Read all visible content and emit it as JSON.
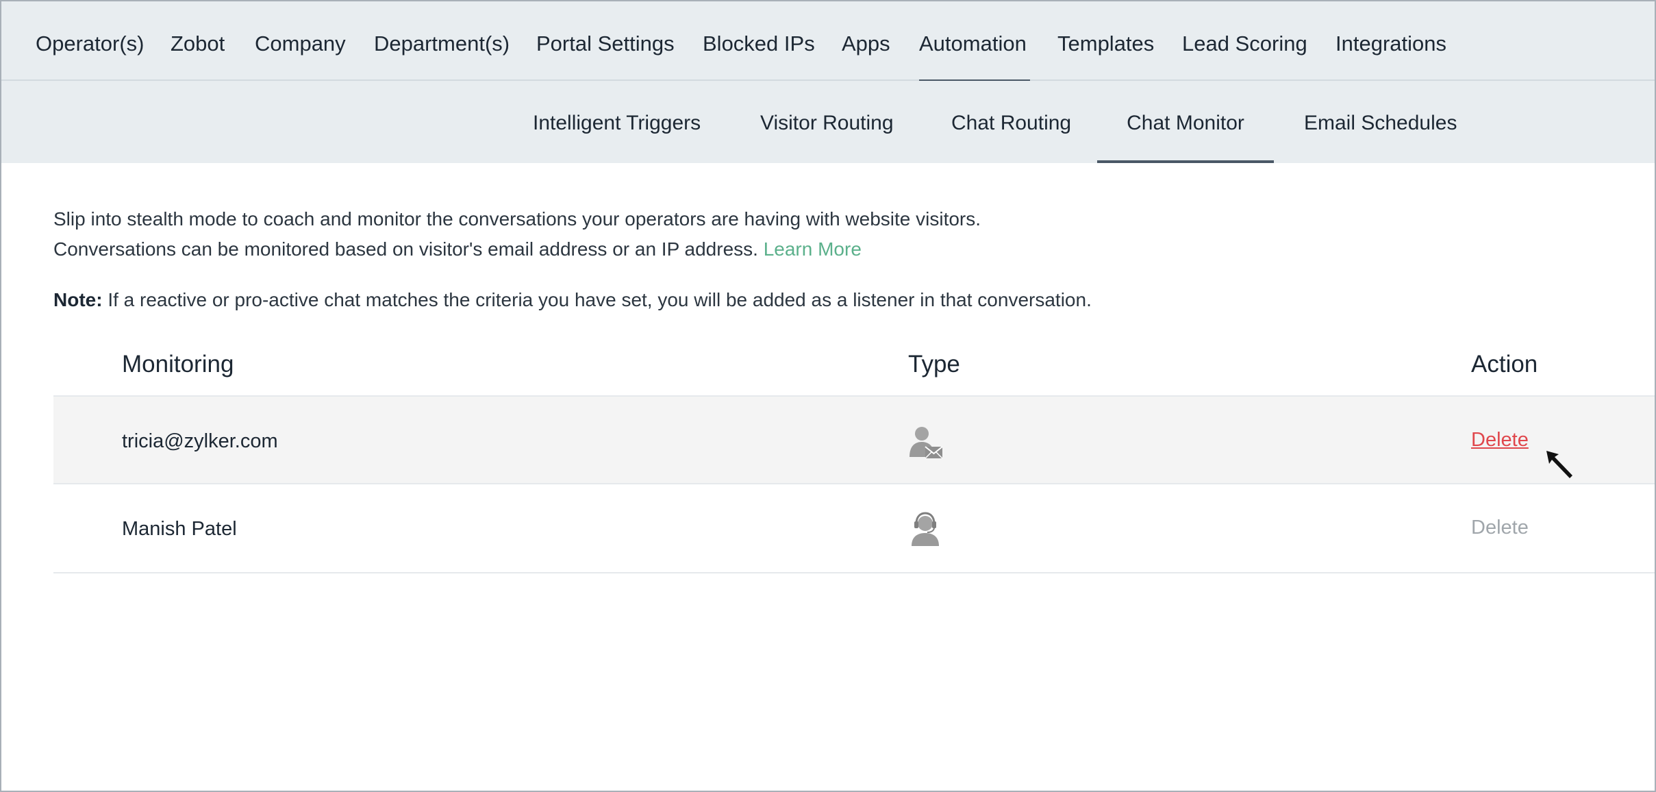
{
  "top_tabs": [
    {
      "label": "Operator(s)"
    },
    {
      "label": "Zobot"
    },
    {
      "label": "Company"
    },
    {
      "label": "Department(s)"
    },
    {
      "label": "Portal Settings"
    },
    {
      "label": "Blocked IPs"
    },
    {
      "label": "Apps"
    },
    {
      "label": "Automation",
      "active": true
    },
    {
      "label": "Templates"
    },
    {
      "label": "Lead Scoring"
    },
    {
      "label": "Integrations"
    }
  ],
  "sub_tabs": [
    {
      "label": "Intelligent Triggers"
    },
    {
      "label": "Visitor Routing"
    },
    {
      "label": "Chat Routing"
    },
    {
      "label": "Chat Monitor",
      "active": true
    },
    {
      "label": "Email Schedules"
    }
  ],
  "description": {
    "line1": "Slip into stealth mode to coach and monitor the conversations your operators are having with website visitors.",
    "line2": "Conversations can be monitored based on visitor's email address or an IP address.",
    "learn_more": "Learn More"
  },
  "note": {
    "label": "Note:",
    "text": " If a reactive or pro-active chat matches the criteria you have set, you will be added as a listener in that conversation."
  },
  "table": {
    "headers": {
      "monitoring": "Monitoring",
      "type": "Type",
      "action": "Action"
    },
    "rows": [
      {
        "name": "tricia@zylker.com",
        "type_icon": "visitor-email-icon",
        "action": "Delete"
      },
      {
        "name": "Manish Patel",
        "type_icon": "operator-headset-icon",
        "action": "Delete"
      }
    ]
  },
  "colors": {
    "nav_bg": "#e8edf0",
    "active_underline": "#4a5866",
    "link_green": "#5bb08b",
    "delete_red": "#e0474c",
    "delete_muted": "#a0a6ab"
  }
}
